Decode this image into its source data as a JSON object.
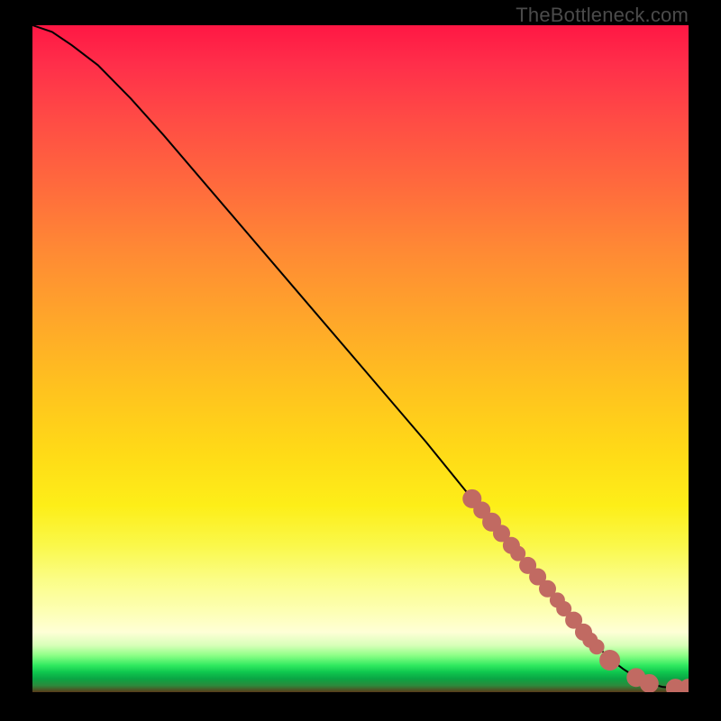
{
  "watermark": "TheBottleneck.com",
  "colors": {
    "dot": "#c16a62",
    "line": "#000000"
  },
  "chart_data": {
    "type": "line",
    "title": "",
    "xlabel": "",
    "ylabel": "",
    "xlim": [
      0,
      100
    ],
    "ylim": [
      0,
      100
    ],
    "line": {
      "x": [
        0,
        3,
        6,
        10,
        15,
        20,
        30,
        40,
        50,
        60,
        67,
        70,
        73,
        76,
        79,
        82,
        84,
        86,
        88,
        90,
        92,
        94,
        96,
        98,
        100
      ],
      "y": [
        100,
        99,
        97,
        94,
        89,
        83.5,
        72,
        60.5,
        49,
        37.5,
        29,
        25.5,
        22,
        18.5,
        15,
        11.5,
        9,
        7,
        5,
        3.5,
        2.2,
        1.3,
        0.8,
        0.6,
        0.6
      ]
    },
    "dots": {
      "x": [
        67,
        68.5,
        70,
        71.5,
        73,
        74,
        75.5,
        77,
        78.5,
        80,
        81,
        82.5,
        84,
        85,
        86,
        88,
        92,
        94,
        98,
        100
      ],
      "y": [
        29,
        27.3,
        25.5,
        23.8,
        22,
        20.8,
        19,
        17.3,
        15.5,
        13.8,
        12.5,
        10.8,
        9,
        7.8,
        6.8,
        4.8,
        2.2,
        1.3,
        0.6,
        0.6
      ],
      "r": [
        10,
        9,
        10,
        9,
        9,
        8,
        9,
        9,
        9,
        8,
        8,
        9,
        9,
        8,
        8,
        11,
        10,
        10,
        10,
        10
      ]
    }
  }
}
